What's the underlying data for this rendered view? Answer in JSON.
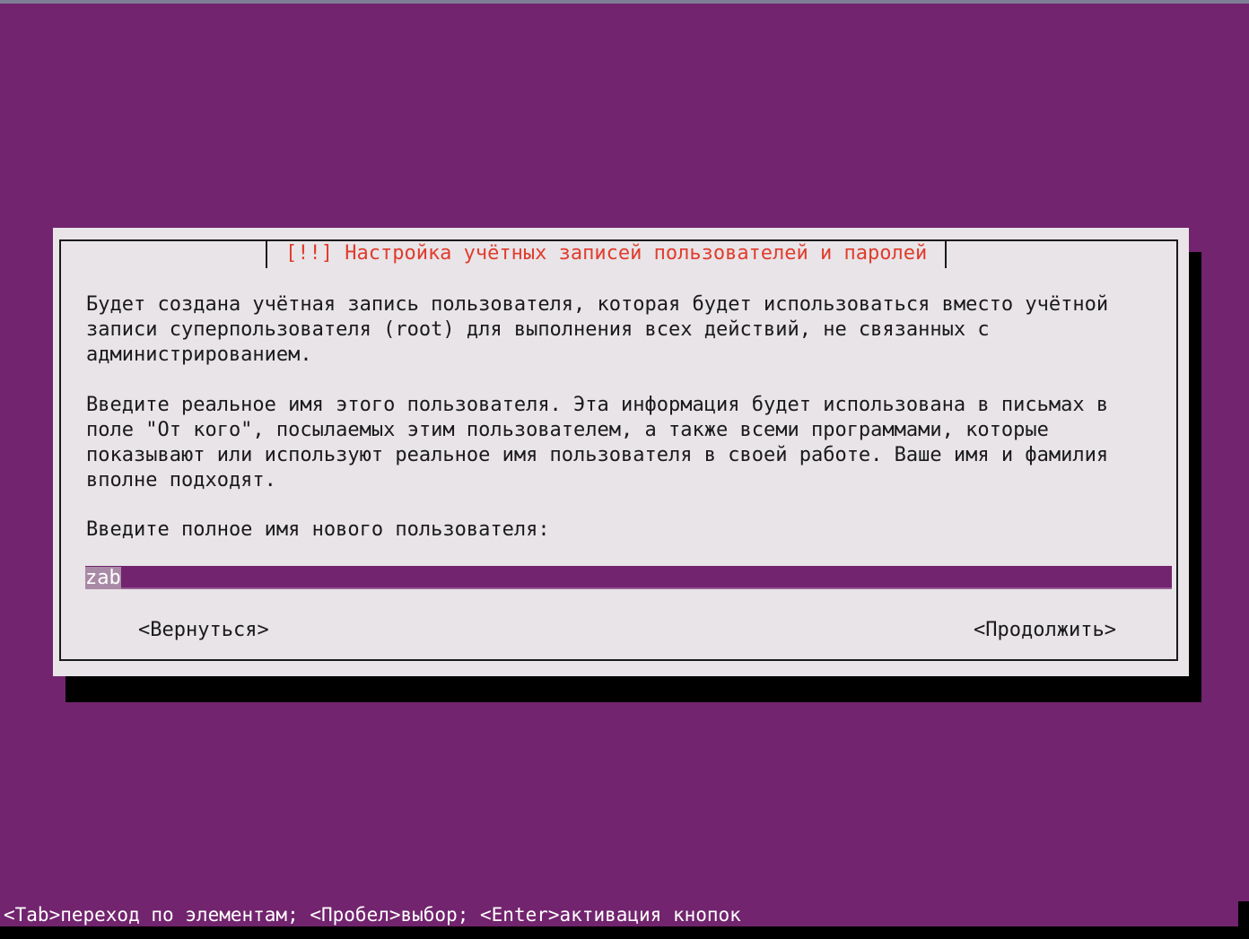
{
  "colors": {
    "background": "#72246e",
    "dialog_bg": "#e8e4e8",
    "title_color": "#e03c2c",
    "input_bg": "#72246e",
    "shadow": "#000000"
  },
  "dialog": {
    "title": "[!!] Настройка учётных записей пользователей и паролей",
    "paragraph1": "Будет создана учётная запись пользователя, которая будет использоваться вместо учётной\nзаписи суперпользователя (root) для выполнения всех действий, не связанных с\nадминистрированием.",
    "paragraph2": "Введите реальное имя этого пользователя. Эта информация будет использована в письмах в\nполе \"От кого\", посылаемых этим пользователем, а также всеми программами, которые\nпоказывают или используют реальное имя пользователя в своей работе. Ваше имя и фамилия\nвполне подходят.",
    "prompt": "Введите полное имя нового пользователя:",
    "input_value": "zab",
    "back_button": "<Вернуться>",
    "continue_button": "<Продолжить>"
  },
  "footer": {
    "hint": "<Tab>переход по элементам; <Пробел>выбор; <Enter>активация кнопок"
  }
}
